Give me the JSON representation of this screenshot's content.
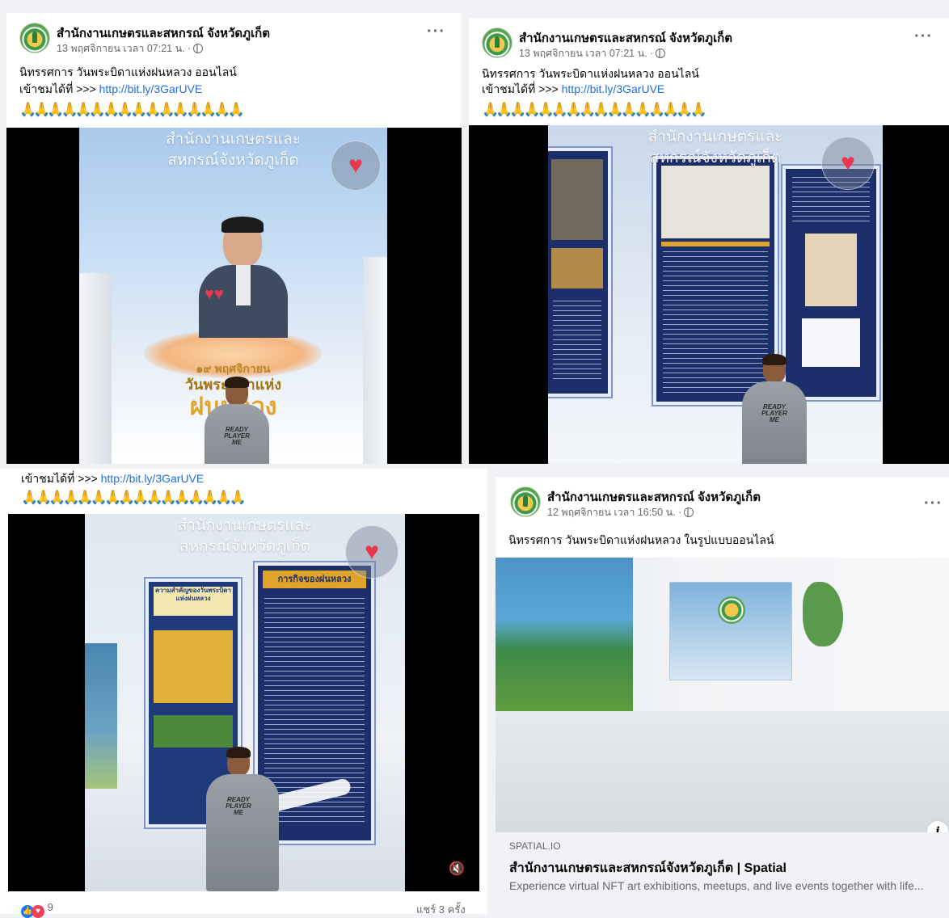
{
  "page": {
    "name": "สำนักงานเกษตรและสหกรณ์ จังหวัดภูเก็ต"
  },
  "posts": [
    {
      "author": "สำนักงานเกษตรและสหกรณ์ จังหวัดภูเก็ต",
      "meta": "13 พฤศจิกายน เวลา 07:21 น. ·",
      "line1": "นิทรรศการ วันพระบิดาแห่งฝนหลวง ออนไลน์",
      "line2_prefix": "เข้าชมได้ที่ >>> ",
      "link": "http://bit.ly/3GarUVE",
      "emoji": "🙏🙏🙏🙏🙏🙏🙏🙏🙏🙏🙏🙏🙏🙏🙏🙏",
      "video_overlay": [
        "สำนักงานเกษตรและ",
        "สหกรณ์จังหวัดภูเก็ต"
      ],
      "video_caption": [
        "๑๙ พฤศจิกายน",
        "วันพระบิดาแห่ง",
        "ฝนหลวง"
      ],
      "shirt": "READY PLAYER ME"
    },
    {
      "author": "สำนักงานเกษตรและสหกรณ์ จังหวัดภูเก็ต",
      "meta": "13 พฤศจิกายน เวลา 07:21 น. ·",
      "line1": "นิทรรศการ วันพระบิดาแห่งฝนหลวง ออนไลน์",
      "line2_prefix": "เข้าชมได้ที่ >>> ",
      "link": "http://bit.ly/3GarUVE",
      "emoji": "🙏🙏🙏🙏🙏🙏🙏🙏🙏🙏🙏🙏🙏🙏🙏🙏",
      "video_overlay": [
        "สำนักงานเกษตรและ",
        "สหกรณ์จังหวัดภูเก็ต"
      ],
      "shirt": "READY PLAYER ME"
    },
    {
      "line2_prefix": "เข้าชมได้ที่ >>> ",
      "link": "http://bit.ly/3GarUVE",
      "emoji": "🙏🙏🙏🙏🙏🙏🙏🙏🙏🙏🙏🙏🙏🙏🙏🙏",
      "video_overlay": [
        "สำนักงานเกษตรและ",
        "สหกรณ์จังหวัดภูเก็ต"
      ],
      "poster_title": "การกิจของฝนหลวง",
      "poster_left_title": "ความสำคัญของวันพระบิดาแห่งฝนหลวง",
      "shirt": "READY PLAYER ME",
      "reaction_count": "9",
      "shares": "แชร์ 3 ครั้ง"
    },
    {
      "author": "สำนักงานเกษตรและสหกรณ์ จังหวัดภูเก็ต",
      "meta": "12 พฤศจิกายน เวลา 16:50 น. ·",
      "line1": "นิทรรศการ วันพระบิดาแห่งฝนหลวง ในรูปแบบออนไลน์",
      "link_source": "SPATIAL.IO",
      "link_title": "สำนักงานเกษตรและสหกรณ์จังหวัดภูเก็ต | Spatial",
      "link_desc": "Experience virtual NFT art exhibitions, meetups, and live events together with life..."
    }
  ]
}
